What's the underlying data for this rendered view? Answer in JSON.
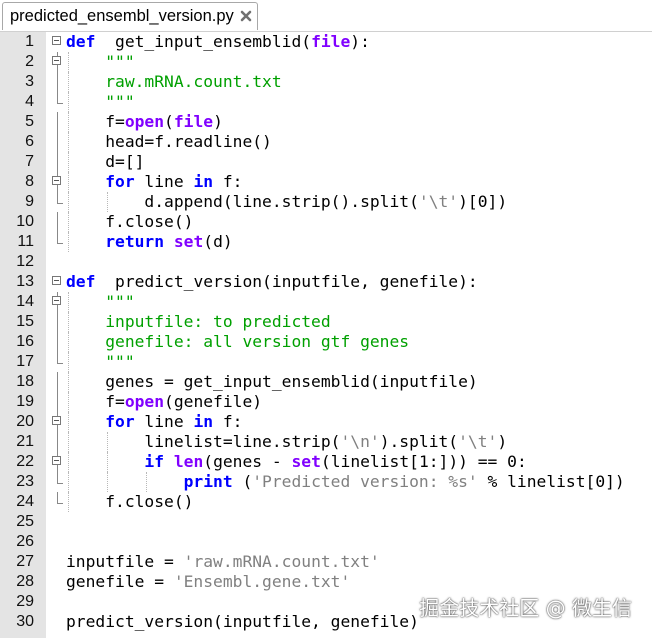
{
  "tab": {
    "filename": "predicted_ensembl_version.py"
  },
  "watermark": "掘金技术社区 @ 微生信",
  "code_lines": [
    {
      "n": "1",
      "fold": "start",
      "tokens": [
        [
          "kw",
          "def"
        ],
        [
          "",
          "  get_input_ensemblid("
        ],
        [
          "bi",
          "file"
        ],
        [
          "",
          "):"
        ]
      ]
    },
    {
      "n": "2",
      "fold": "box",
      "guides": [
        1
      ],
      "tokens": [
        [
          "doc",
          "    \"\"\""
        ]
      ]
    },
    {
      "n": "3",
      "fold": "line",
      "guides": [
        1
      ],
      "tokens": [
        [
          "doc",
          "    raw.mRNA.count.txt"
        ]
      ]
    },
    {
      "n": "4",
      "fold": "end",
      "guides": [
        1
      ],
      "tokens": [
        [
          "doc",
          "    \"\"\""
        ]
      ]
    },
    {
      "n": "5",
      "fold": "line",
      "guides": [
        1
      ],
      "tokens": [
        [
          "",
          "    f="
        ],
        [
          "bi",
          "open"
        ],
        [
          "",
          "("
        ],
        [
          "bi",
          "file"
        ],
        [
          "",
          ")"
        ]
      ]
    },
    {
      "n": "6",
      "fold": "line",
      "guides": [
        1
      ],
      "tokens": [
        [
          "",
          "    head=f.readline()"
        ]
      ]
    },
    {
      "n": "7",
      "fold": "line",
      "guides": [
        1
      ],
      "tokens": [
        [
          "",
          "    d=[]"
        ]
      ]
    },
    {
      "n": "8",
      "fold": "box",
      "guides": [
        1
      ],
      "tokens": [
        [
          "kw",
          "    for"
        ],
        [
          "",
          " line "
        ],
        [
          "kw",
          "in"
        ],
        [
          "",
          " f:"
        ]
      ]
    },
    {
      "n": "9",
      "fold": "end",
      "guides": [
        1,
        2
      ],
      "tokens": [
        [
          "",
          "        d.append(line.strip().split("
        ],
        [
          "str",
          "'\\t'"
        ],
        [
          "",
          ")[0])"
        ]
      ]
    },
    {
      "n": "10",
      "fold": "line",
      "guides": [
        1
      ],
      "tokens": [
        [
          "",
          "    f.close()"
        ]
      ]
    },
    {
      "n": "11",
      "fold": "end",
      "guides": [
        1
      ],
      "tokens": [
        [
          "kw",
          "    return"
        ],
        [
          "",
          " "
        ],
        [
          "bi",
          "set"
        ],
        [
          "",
          "(d)"
        ]
      ]
    },
    {
      "n": "12",
      "fold": "",
      "tokens": []
    },
    {
      "n": "13",
      "fold": "start",
      "tokens": [
        [
          "kw",
          "def"
        ],
        [
          "",
          "  predict_version(inputfile, genefile):"
        ]
      ]
    },
    {
      "n": "14",
      "fold": "box",
      "guides": [
        1
      ],
      "tokens": [
        [
          "doc",
          "    \"\"\""
        ]
      ]
    },
    {
      "n": "15",
      "fold": "line",
      "guides": [
        1
      ],
      "tokens": [
        [
          "doc",
          "    inputfile: to predicted"
        ]
      ]
    },
    {
      "n": "16",
      "fold": "line",
      "guides": [
        1
      ],
      "tokens": [
        [
          "doc",
          "    genefile: all version gtf genes"
        ]
      ]
    },
    {
      "n": "17",
      "fold": "end",
      "guides": [
        1
      ],
      "tokens": [
        [
          "doc",
          "    \"\"\""
        ]
      ]
    },
    {
      "n": "18",
      "fold": "line",
      "guides": [
        1
      ],
      "tokens": [
        [
          "",
          "    genes = get_input_ensemblid(inputfile)"
        ]
      ]
    },
    {
      "n": "19",
      "fold": "line",
      "guides": [
        1
      ],
      "tokens": [
        [
          "",
          "    f="
        ],
        [
          "bi",
          "open"
        ],
        [
          "",
          "(genefile)"
        ]
      ]
    },
    {
      "n": "20",
      "fold": "box",
      "guides": [
        1
      ],
      "tokens": [
        [
          "kw",
          "    for"
        ],
        [
          "",
          " line "
        ],
        [
          "kw",
          "in"
        ],
        [
          "",
          " f:"
        ]
      ]
    },
    {
      "n": "21",
      "fold": "line",
      "guides": [
        1,
        2
      ],
      "tokens": [
        [
          "",
          "        linelist=line.strip("
        ],
        [
          "str",
          "'\\n'"
        ],
        [
          "",
          ").split("
        ],
        [
          "str",
          "'\\t'"
        ],
        [
          "",
          ")"
        ]
      ]
    },
    {
      "n": "22",
      "fold": "box",
      "guides": [
        1,
        2
      ],
      "tokens": [
        [
          "kw",
          "        if"
        ],
        [
          "",
          " "
        ],
        [
          "bi",
          "len"
        ],
        [
          "",
          "(genes - "
        ],
        [
          "bi",
          "set"
        ],
        [
          "",
          "(linelist[1:])) == 0:"
        ]
      ]
    },
    {
      "n": "23",
      "fold": "end",
      "guides": [
        1,
        2,
        3
      ],
      "tokens": [
        [
          "kw",
          "            print"
        ],
        [
          "",
          " ("
        ],
        [
          "str",
          "'Predicted version: %s'"
        ],
        [
          "",
          " % linelist[0])"
        ]
      ]
    },
    {
      "n": "24",
      "fold": "end",
      "guides": [
        1
      ],
      "tokens": [
        [
          "",
          "    f.close()"
        ]
      ]
    },
    {
      "n": "25",
      "fold": "",
      "tokens": []
    },
    {
      "n": "26",
      "fold": "",
      "tokens": []
    },
    {
      "n": "27",
      "fold": "",
      "tokens": [
        [
          "",
          "inputfile = "
        ],
        [
          "str",
          "'raw.mRNA.count.txt'"
        ]
      ]
    },
    {
      "n": "28",
      "fold": "",
      "tokens": [
        [
          "",
          "genefile = "
        ],
        [
          "str",
          "'Ensembl.gene.txt'"
        ]
      ]
    },
    {
      "n": "29",
      "fold": "",
      "tokens": []
    },
    {
      "n": "30",
      "fold": "",
      "tokens": [
        [
          "",
          "predict_version(inputfile, genefile)"
        ]
      ]
    }
  ]
}
